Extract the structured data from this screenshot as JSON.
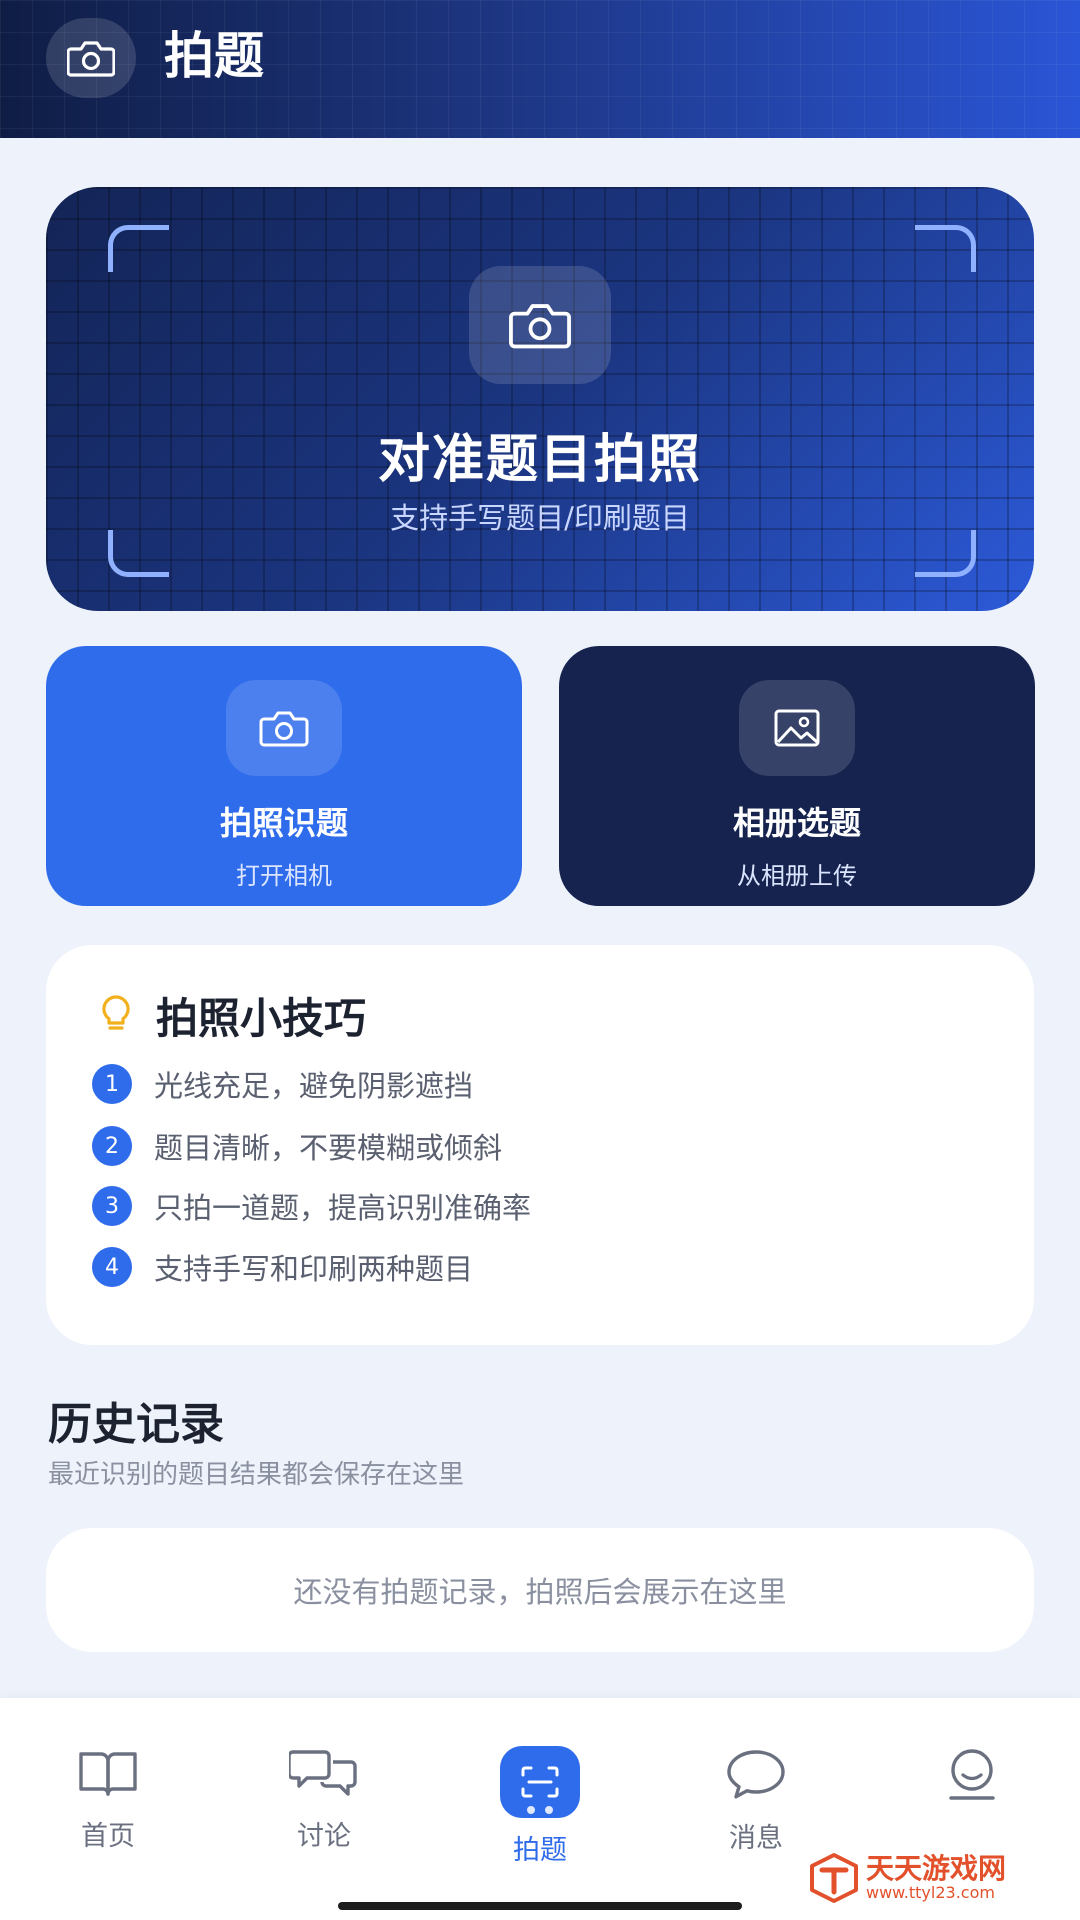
{
  "header": {
    "title": "拍题",
    "icon": "camera-icon"
  },
  "hero": {
    "title": "对准题目拍照",
    "subtitle": "支持手写题目/印刷题目",
    "icon": "camera-icon"
  },
  "actions": [
    {
      "title": "拍照识题",
      "subtitle": "打开相机",
      "icon": "camera-icon",
      "color": "#2f6cec"
    },
    {
      "title": "相册选题",
      "subtitle": "从相册上传",
      "icon": "image-icon",
      "color": "#15234e"
    }
  ],
  "tips": {
    "title": "拍照小技巧",
    "icon": "lightbulb-icon",
    "items": [
      {
        "num": "1",
        "text": "光线充足，避免阴影遮挡"
      },
      {
        "num": "2",
        "text": "题目清晰，不要模糊或倾斜"
      },
      {
        "num": "3",
        "text": "只拍一道题，提高识别准确率"
      },
      {
        "num": "4",
        "text": "支持手写和印刷两种题目"
      }
    ]
  },
  "history": {
    "title": "历史记录",
    "subtitle": "最近识别的题目结果都会保存在这里",
    "empty_text": "还没有拍题记录，拍照后会展示在这里"
  },
  "nav": {
    "items": [
      {
        "label": "首页",
        "icon": "book-icon"
      },
      {
        "label": "讨论",
        "icon": "chat-bubbles-icon"
      },
      {
        "label": "拍题",
        "icon": "scan-icon",
        "active": true
      },
      {
        "label": "消息",
        "icon": "message-icon"
      },
      {
        "label": "",
        "icon": "profile-icon"
      }
    ]
  },
  "watermark": {
    "name": "天天游戏网",
    "url": "www.ttyl23.com"
  },
  "colors": {
    "accent": "#2f6cec",
    "dark": "#15234e",
    "background": "#eef2fb",
    "watermark": "#e2512b"
  }
}
